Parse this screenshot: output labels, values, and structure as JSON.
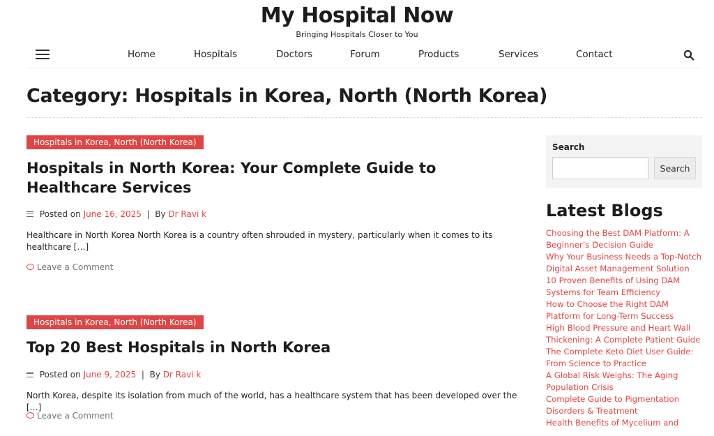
{
  "site": {
    "title": "My Hospital Now",
    "tagline": "Bringing Hospitals Closer to You"
  },
  "nav": {
    "items": [
      "Home",
      "Hospitals",
      "Doctors",
      "Forum",
      "Products",
      "Services",
      "Contact"
    ]
  },
  "page": {
    "title": "Category: Hospitals in Korea, North (North Korea)"
  },
  "posts": [
    {
      "category": "Hospitals in Korea, North (North Korea)",
      "title": "Hospitals in North Korea: Your Complete Guide to Healthcare Services",
      "posted_on_label": "Posted on",
      "date": "June 16, 2025",
      "sep": "|",
      "by_label": "By",
      "author": "Dr Ravi k",
      "excerpt": "Healthcare in North Korea North Korea is a country often shrouded in mystery, particularly when it comes to its healthcare […]",
      "comment": "Leave a Comment"
    },
    {
      "category": "Hospitals in Korea, North (North Korea)",
      "title": "Top 20 Best Hospitals in North Korea",
      "posted_on_label": "Posted on",
      "date": "June 9, 2025",
      "sep": "|",
      "by_label": "By",
      "author": "Dr Ravi k",
      "excerpt": "North Korea, despite its isolation from much of the world, has a healthcare system that has been developed over the […]",
      "comment": "Leave a Comment"
    }
  ],
  "sidebar": {
    "search_label": "Search",
    "search_value": "",
    "search_button": "Search",
    "latest_title": "Latest Blogs",
    "latest_items": [
      "Choosing the Best DAM Platform: A Beginner’s Decision Guide",
      "Why Your Business Needs a Top-Notch Digital Asset Management Solution",
      "10 Proven Benefits of Using DAM Systems for Team Efficiency",
      "How to Choose the Right DAM Platform for Long-Term Success",
      "High Blood Pressure and Heart Wall Thickening: A Complete Patient Guide",
      "The Complete Keto Diet User Guide: From Science to Practice",
      "A Global Risk Weighs: The Aging Population Crisis",
      "Complete Guide to Pigmentation Disorders & Treatment",
      "Health Benefits of Mycelium and"
    ]
  },
  "colors": {
    "accent": "#e04545",
    "text": "#222222"
  },
  "icons": {
    "menu": "hamburger-icon",
    "search": "search-icon",
    "meta": "list-lines-icon",
    "comment": "comment-icon"
  }
}
